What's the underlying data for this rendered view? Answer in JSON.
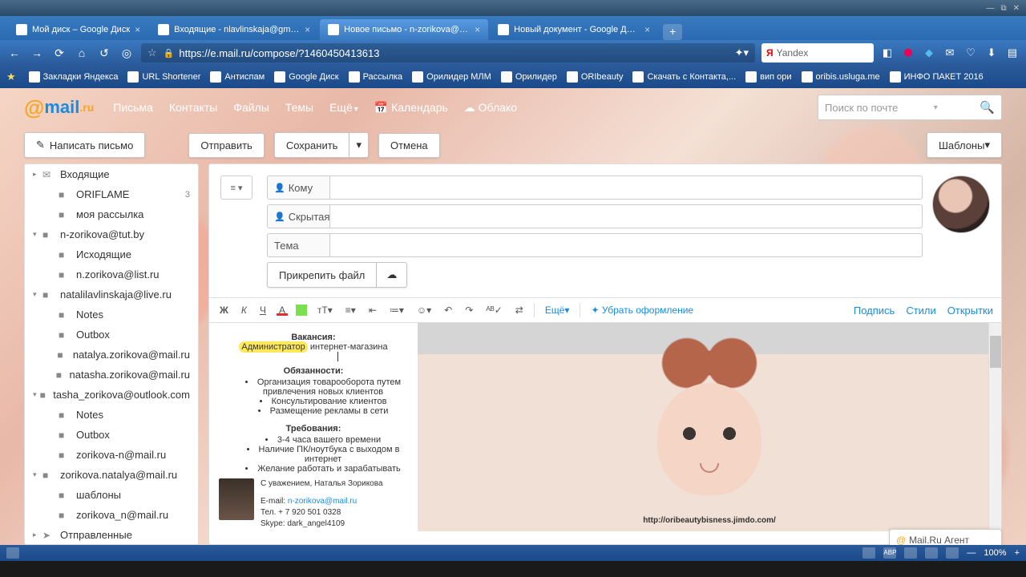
{
  "window": {
    "min": "—",
    "max": "▢",
    "close": "✕",
    "restore": "⧉"
  },
  "tabs": [
    {
      "label": "Мой диск – Google Диск"
    },
    {
      "label": "Входящие - nlavlinskaja@gmail..."
    },
    {
      "label": "Новое письмо - n-zorikova@m...",
      "active": true
    },
    {
      "label": "Новый документ - Google Доку..."
    }
  ],
  "url": "https://e.mail.ru/compose/?1460450413613",
  "yandex_placeholder": "Yandex",
  "bookmarks": [
    "Закладки Яндекса",
    "URL Shortener",
    "Антиспам",
    "Google Диск",
    "Рассылка",
    "Орилидер МЛМ",
    "Орилидер",
    "ORIbeauty",
    "Скачать с Контакта,...",
    "вип ори",
    "oribis.usluga.me",
    "ИНФО ПАКЕТ 2016"
  ],
  "mailnav": {
    "letters": "Письма",
    "contacts": "Контакты",
    "files": "Файлы",
    "themes": "Темы",
    "more": "Ещё",
    "calendar": "Календарь",
    "cloud": "Облако"
  },
  "search_placeholder": "Поиск по почте",
  "compose_btn": "Написать письмо",
  "actions": {
    "send": "Отправить",
    "save": "Сохранить",
    "cancel": "Отмена",
    "templates": "Шаблоны"
  },
  "fields": {
    "to": "Кому",
    "bcc": "Скрытая",
    "subject": "Тема",
    "attach": "Прикрепить файл"
  },
  "sidebar": [
    {
      "t": "Входящие",
      "l": 1,
      "i": "✉",
      "a": "▸"
    },
    {
      "t": "ORIFLAME",
      "l": 2,
      "i": "■",
      "badge": "3"
    },
    {
      "t": "моя рассылка",
      "l": 2,
      "i": "■"
    },
    {
      "t": "n-zorikova@tut.by",
      "l": 1,
      "i": "■",
      "a": "▾"
    },
    {
      "t": "Исходящие",
      "l": 2,
      "i": "■"
    },
    {
      "t": "n.zorikova@list.ru",
      "l": 2,
      "i": "■"
    },
    {
      "t": "natalilavlinskaja@live.ru",
      "l": 1,
      "i": "■",
      "a": "▾"
    },
    {
      "t": "Notes",
      "l": 2,
      "i": "■"
    },
    {
      "t": "Outbox",
      "l": 2,
      "i": "■"
    },
    {
      "t": "natalya.zorikova@mail.ru",
      "l": 2,
      "i": "■"
    },
    {
      "t": "natasha.zorikova@mail.ru",
      "l": 2,
      "i": "■"
    },
    {
      "t": "tasha_zorikova@outlook.com",
      "l": 1,
      "i": "■",
      "a": "▾"
    },
    {
      "t": "Notes",
      "l": 2,
      "i": "■"
    },
    {
      "t": "Outbox",
      "l": 2,
      "i": "■"
    },
    {
      "t": "zorikova-n@mail.ru",
      "l": 2,
      "i": "■"
    },
    {
      "t": "zorikova.natalya@mail.ru",
      "l": 1,
      "i": "■",
      "a": "▾"
    },
    {
      "t": "шаблоны",
      "l": 2,
      "i": "■"
    },
    {
      "t": "zorikova_n@mail.ru",
      "l": 2,
      "i": "■"
    },
    {
      "t": "Отправленные",
      "l": 1,
      "i": "➤",
      "a": "▸"
    }
  ],
  "editor_more": "Ещё",
  "editor_clear": "Убрать оформление",
  "editor_right": {
    "sign": "Подпись",
    "styles": "Стили",
    "cards": "Открытки"
  },
  "body": {
    "vac_h": "Вакансия:",
    "vac_t1": "Администратор",
    "vac_t2": " интернет-магазина",
    "dut_h": "Обязанности:",
    "dut": [
      "Организация товарооборота путем привлечения новых клиентов",
      "Консультирование клиентов",
      "Размещение рекламы в сети"
    ],
    "req_h": "Требования:",
    "req": [
      "3-4 часа вашего времени",
      "Наличие ПК/ноутбука с выходом в интернет",
      "Желание работать и зарабатывать"
    ],
    "sig_name": "С уважением, Наталья Зорикова",
    "sig_email_l": "E-mail: ",
    "sig_email": "n-zorikova@mail.ru",
    "sig_tel": "Тел. + 7 920 501 0328",
    "sig_skype": "Skype: dark_angel4109",
    "url": "http://oribeautybisness.jimdo.com/"
  },
  "agent": "Mail.Ru Агент",
  "zoom": "100%"
}
